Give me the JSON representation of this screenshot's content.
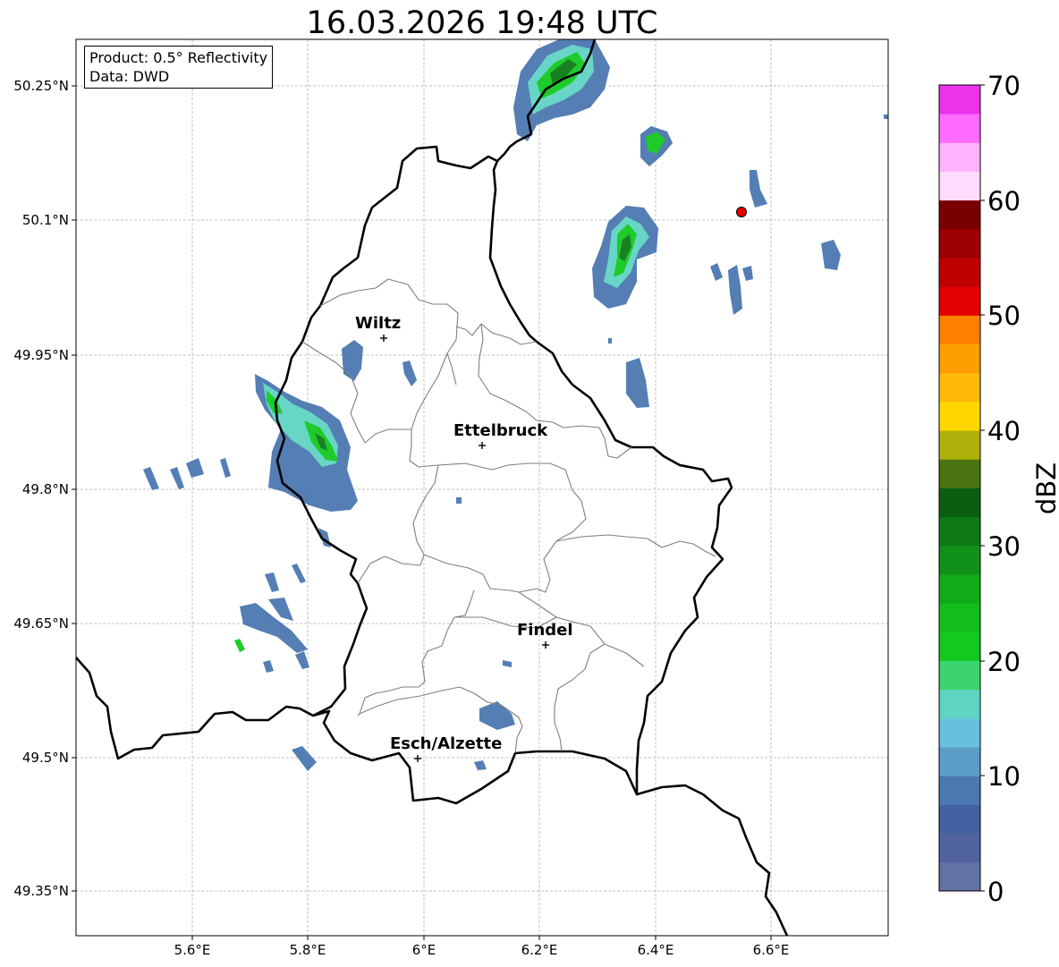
{
  "title": "16.03.2026 19:48 UTC",
  "info_box": {
    "product": "Product: 0.5° Reflectivity",
    "data": "Data: DWD"
  },
  "lat_labels": [
    "50.25°N",
    "50.1°N",
    "49.95°N",
    "49.8°N",
    "49.65°N",
    "49.5°N",
    "49.35°N"
  ],
  "lon_labels": [
    "5.6°E",
    "5.8°E",
    "6°E",
    "6.2°E",
    "6.4°E",
    "6.6°E"
  ],
  "cities": [
    {
      "name": "Wiltz"
    },
    {
      "name": "Ettelbruck"
    },
    {
      "name": "Findel"
    },
    {
      "name": "Esch/Alzette"
    }
  ],
  "colorbar": {
    "label": "dBZ",
    "ticks": [
      "70",
      "60",
      "50",
      "40",
      "30",
      "20",
      "10",
      "0"
    ],
    "min": 0,
    "max": 70,
    "step": 2.5,
    "colors": [
      "#6272a4",
      "#51639d",
      "#4360a1",
      "#4b78b1",
      "#5a9ec7",
      "#68c1dc",
      "#60d4c3",
      "#3cd46c",
      "#12c91f",
      "#12bf1a",
      "#13aa17",
      "#11911a",
      "#0d7a16",
      "#0a5e12",
      "#4a7510",
      "#b0b00a",
      "#ffd700",
      "#ffb90a",
      "#ff9e00",
      "#ff8000",
      "#e20000",
      "#c00000",
      "#9c0000",
      "#7a0000",
      "#ffdcff",
      "#ffb2ff",
      "#ff6bff",
      "#eb33eb"
    ]
  },
  "marker_color": "#e60000"
}
